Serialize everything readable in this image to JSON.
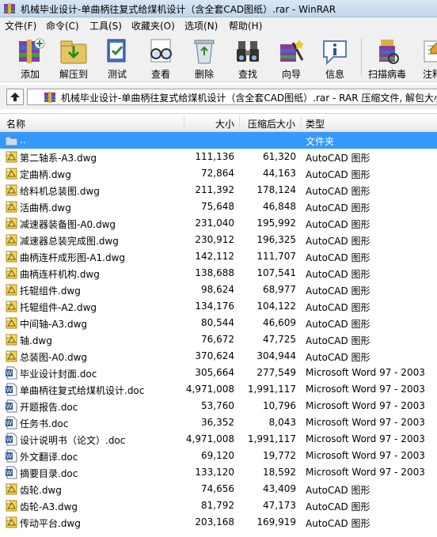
{
  "window": {
    "title": "机械毕业设计-单曲柄往复式给煤机设计（含全套CAD图纸）.rar - WinRAR"
  },
  "menu": [
    "文件(F)",
    "命令(C)",
    "工具(S)",
    "收藏夹(O)",
    "选项(N)",
    "帮助(H)"
  ],
  "toolbar": {
    "add": "添加",
    "extract": "解压到",
    "test": "测试",
    "view": "查看",
    "delete": "删除",
    "find": "查找",
    "wizard": "向导",
    "info": "信息",
    "virus_scan": "扫描病毒",
    "comment": "注释"
  },
  "address": {
    "path": "机械毕业设计-单曲柄往复式给煤机设计（含全套CAD图纸）.rar - RAR 压缩文件, 解包大小"
  },
  "columns": {
    "name": "名称",
    "size": "大小",
    "packed": "压缩后大小",
    "type": "类型"
  },
  "files": [
    {
      "name": "..",
      "size": "",
      "packed": "",
      "type": "文件夹",
      "kind": "up",
      "selected": true
    },
    {
      "name": "第二轴系-A3.dwg",
      "size": "111,136",
      "packed": "61,320",
      "type": "AutoCAD 图形",
      "kind": "dwg"
    },
    {
      "name": "定曲柄.dwg",
      "size": "72,864",
      "packed": "44,163",
      "type": "AutoCAD 图形",
      "kind": "dwg"
    },
    {
      "name": "给料机总装图.dwg",
      "size": "211,392",
      "packed": "178,124",
      "type": "AutoCAD 图形",
      "kind": "dwg"
    },
    {
      "name": "活曲柄.dwg",
      "size": "75,648",
      "packed": "46,848",
      "type": "AutoCAD 图形",
      "kind": "dwg"
    },
    {
      "name": "减速器装备图-A0.dwg",
      "size": "231,040",
      "packed": "195,992",
      "type": "AutoCAD 图形",
      "kind": "dwg"
    },
    {
      "name": "减速器总装完成图.dwg",
      "size": "230,912",
      "packed": "196,325",
      "type": "AutoCAD 图形",
      "kind": "dwg"
    },
    {
      "name": "曲柄连杆成形图-A1.dwg",
      "size": "142,112",
      "packed": "111,707",
      "type": "AutoCAD 图形",
      "kind": "dwg"
    },
    {
      "name": "曲柄连杆机构.dwg",
      "size": "138,688",
      "packed": "107,541",
      "type": "AutoCAD 图形",
      "kind": "dwg"
    },
    {
      "name": "托辊组件.dwg",
      "size": "98,624",
      "packed": "68,977",
      "type": "AutoCAD 图形",
      "kind": "dwg"
    },
    {
      "name": "托辊组件-A2.dwg",
      "size": "134,176",
      "packed": "104,122",
      "type": "AutoCAD 图形",
      "kind": "dwg"
    },
    {
      "name": "中间轴-A3.dwg",
      "size": "80,544",
      "packed": "46,609",
      "type": "AutoCAD 图形",
      "kind": "dwg"
    },
    {
      "name": "轴.dwg",
      "size": "76,672",
      "packed": "47,725",
      "type": "AutoCAD 图形",
      "kind": "dwg"
    },
    {
      "name": "总装图-A0.dwg",
      "size": "370,624",
      "packed": "304,944",
      "type": "AutoCAD 图形",
      "kind": "dwg"
    },
    {
      "name": "毕业设计封面.doc",
      "size": "305,664",
      "packed": "277,549",
      "type": "Microsoft Word 97 - 2003",
      "kind": "doc"
    },
    {
      "name": "单曲柄往复式给煤机设计.doc",
      "size": "4,971,008",
      "packed": "1,991,117",
      "type": "Microsoft Word 97 - 2003",
      "kind": "doc"
    },
    {
      "name": "开题报告.doc",
      "size": "53,760",
      "packed": "10,796",
      "type": "Microsoft Word 97 - 2003",
      "kind": "doc"
    },
    {
      "name": "任务书.doc",
      "size": "36,352",
      "packed": "8,043",
      "type": "Microsoft Word 97 - 2003",
      "kind": "doc"
    },
    {
      "name": "设计说明书（论文）.doc",
      "size": "4,971,008",
      "packed": "1,991,117",
      "type": "Microsoft Word 97 - 2003",
      "kind": "doc"
    },
    {
      "name": "外文翻译.doc",
      "size": "69,120",
      "packed": "19,772",
      "type": "Microsoft Word 97 - 2003",
      "kind": "doc"
    },
    {
      "name": "摘要目录.doc",
      "size": "133,120",
      "packed": "18,592",
      "type": "Microsoft Word 97 - 2003",
      "kind": "doc"
    },
    {
      "name": "齿轮.dwg",
      "size": "74,656",
      "packed": "43,409",
      "type": "AutoCAD 图形",
      "kind": "dwg"
    },
    {
      "name": "齿轮-A3.dwg",
      "size": "81,792",
      "packed": "47,173",
      "type": "AutoCAD 图形",
      "kind": "dwg"
    },
    {
      "name": "传动平台.dwg",
      "size": "203,168",
      "packed": "169,919",
      "type": "AutoCAD 图形",
      "kind": "dwg"
    }
  ],
  "colors": {
    "selection": "#3399ff",
    "dwg_icon": "#e8c23a",
    "doc_icon": "#2b5797"
  }
}
